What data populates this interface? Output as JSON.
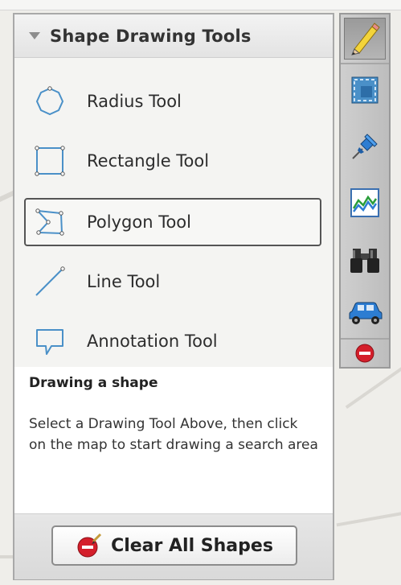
{
  "panel": {
    "title": "Shape Drawing Tools",
    "tools": [
      {
        "label": "Radius Tool",
        "icon": "radius-icon"
      },
      {
        "label": "Rectangle Tool",
        "icon": "rectangle-icon"
      },
      {
        "label": "Polygon Tool",
        "icon": "polygon-icon",
        "selected": true
      },
      {
        "label": "Line Tool",
        "icon": "line-icon"
      },
      {
        "label": "Annotation Tool",
        "icon": "annotation-icon"
      }
    ],
    "help": {
      "title": "Drawing a shape",
      "text": "Select a Drawing Tool Above, then click on the map to start drawing a search area"
    },
    "clear_button": {
      "label": "Clear All Shapes",
      "icon": "clear-shapes-icon"
    }
  },
  "toolbar": {
    "buttons": [
      {
        "icon": "pencil-icon",
        "active": true
      },
      {
        "icon": "select-area-icon"
      },
      {
        "icon": "pushpin-icon"
      },
      {
        "icon": "chart-icon"
      },
      {
        "icon": "binoculars-icon"
      },
      {
        "icon": "car-icon"
      },
      {
        "icon": "no-entry-icon"
      }
    ]
  },
  "colors": {
    "icon_blue": "#4a90c8",
    "accent_red": "#d41f2b",
    "pencil_yellow": "#f3d43a"
  }
}
